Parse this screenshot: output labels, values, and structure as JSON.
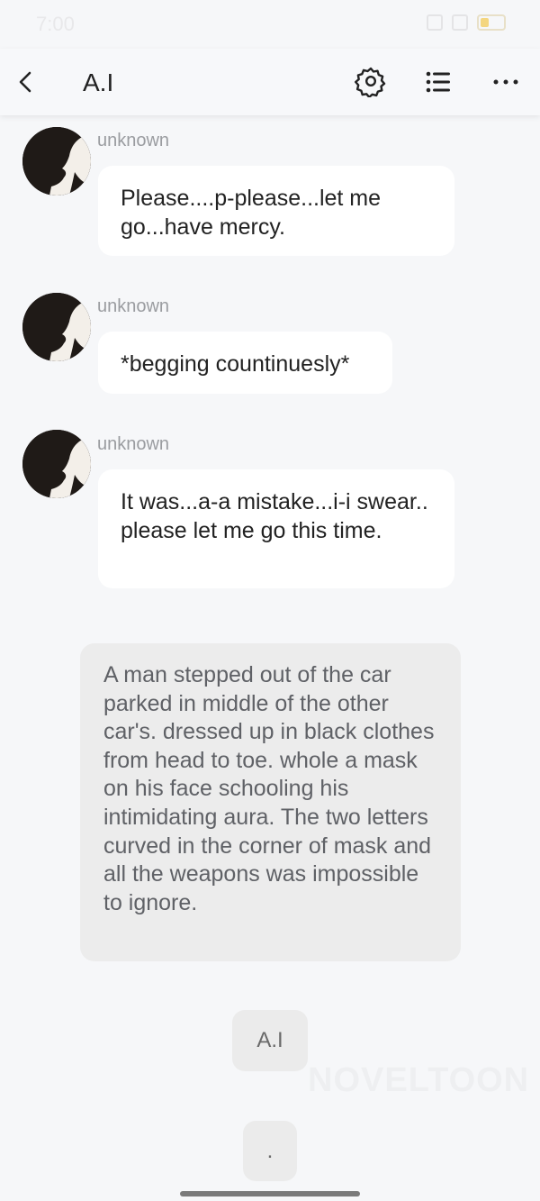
{
  "status_bar": {
    "time": "7:00"
  },
  "app_bar": {
    "title": "A.I"
  },
  "messages": [
    {
      "sender": "unknown",
      "text": "Please....p-please...let me go...have mercy."
    },
    {
      "sender": "unknown",
      "text": "*begging countinuesly*"
    },
    {
      "sender": "unknown",
      "text": "It was...a-a mistake...i-i swear.. please let me go this time."
    }
  ],
  "narration": "A man stepped out of the car parked in middle of the other car's. dressed up in black clothes from head to toe. whole a mask on his face schooling his intimidating aura. The two letters curved in the corner of mask and all the weapons was impossible to ignore.",
  "chips": {
    "ai_label": "A.I",
    "dot_label": "."
  },
  "watermark": "NOVELTOON",
  "icons": {
    "back": "back-arrow-icon",
    "settings": "gear-icon",
    "list": "list-icon",
    "more": "more-icon",
    "avatar": "silhouette-avatar"
  }
}
